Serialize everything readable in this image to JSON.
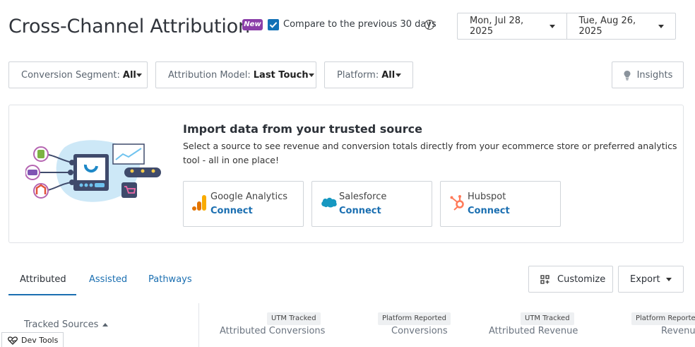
{
  "header": {
    "title": "Cross-Channel Attribution",
    "new_badge": "New",
    "compare_checked": true,
    "compare_label": "Compare to the previous 30 days",
    "start_date": "Mon, Jul 28, 2025",
    "end_date": "Tue, Aug 26, 2025"
  },
  "filters": [
    {
      "key": "Conversion Segment:",
      "value": "All"
    },
    {
      "key": "Attribution Model:",
      "value": "Last Touch"
    },
    {
      "key": "Platform:",
      "value": "All"
    }
  ],
  "insights_label": "Insights",
  "import_card": {
    "title": "Import data from your trusted source",
    "description": "Select a source to see revenue and conversion totals directly from your ecommerce store or preferred analytics tool - all in one place!",
    "sources": [
      {
        "name": "Google Analytics",
        "action": "Connect",
        "icon": "google-analytics-icon"
      },
      {
        "name": "Salesforce",
        "action": "Connect",
        "icon": "salesforce-icon"
      },
      {
        "name": "Hubspot",
        "action": "Connect",
        "icon": "hubspot-icon"
      }
    ]
  },
  "tabs": [
    {
      "label": "Attributed",
      "active": true
    },
    {
      "label": "Assisted",
      "active": false
    },
    {
      "label": "Pathways",
      "active": false
    }
  ],
  "actions": {
    "customize_label": "Customize",
    "export_label": "Export"
  },
  "table": {
    "first_column": "Tracked Sources",
    "columns": [
      {
        "tag": "UTM Tracked",
        "label": "Attributed Conversions"
      },
      {
        "tag": "Platform Reported",
        "label": "Conversions"
      },
      {
        "tag": "UTM Tracked",
        "label": "Attributed Revenue"
      },
      {
        "tag": "Platform Reported",
        "label": "Revenue"
      }
    ]
  },
  "devtools_label": "Dev Tools",
  "colors": {
    "accent": "#1b6fb1",
    "badge": "#8a3ea8",
    "checkbox": "#1170b6"
  }
}
